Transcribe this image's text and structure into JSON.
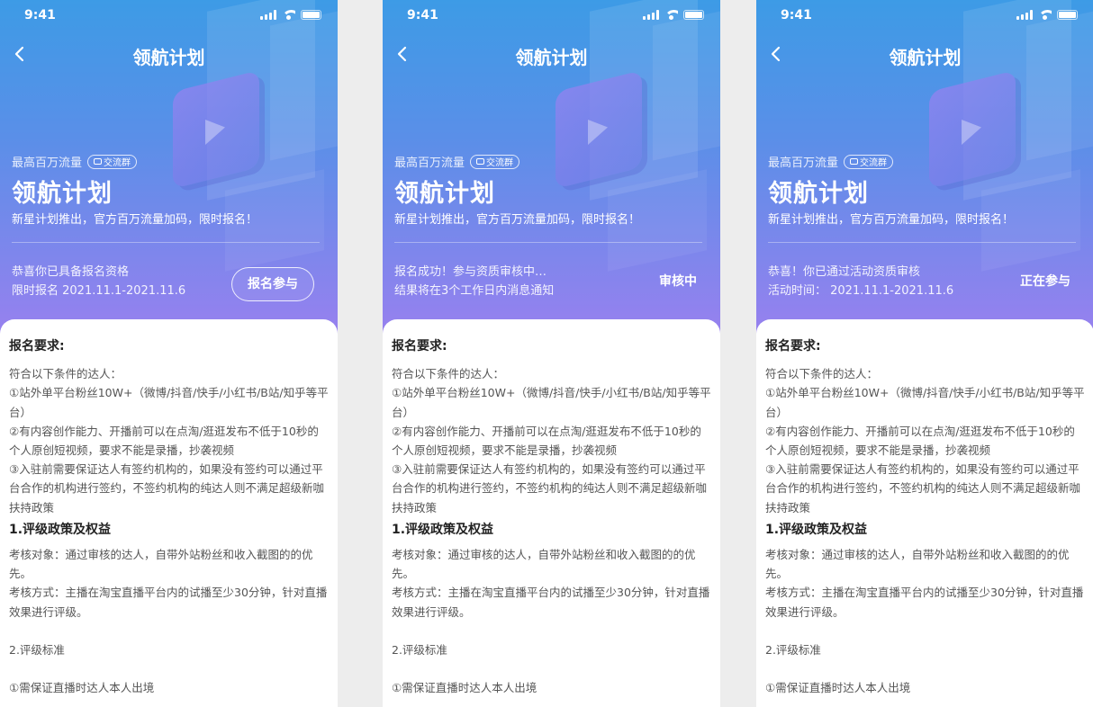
{
  "screens": [
    {
      "status_bar": {
        "time": "9:41"
      },
      "nav_title": "领航计划",
      "hero": {
        "tagline": "最高百万流量",
        "chip_label": "交流群",
        "title": "领航计划",
        "subtitle": "新星计划推出，官方百万流量加码，限时报名！",
        "status_line1": "恭喜你已具备报名资格",
        "status_line2": "限时报名 2021.11.1-2021.11.6",
        "action_label": "报名参与"
      }
    },
    {
      "status_bar": {
        "time": "9:41"
      },
      "nav_title": "领航计划",
      "hero": {
        "tagline": "最高百万流量",
        "chip_label": "交流群",
        "title": "领航计划",
        "subtitle": "新星计划推出，官方百万流量加码，限时报名！",
        "status_line1": "报名成功！参与资质审核中…",
        "status_line2": "结果将在3个工作日内消息通知",
        "state_label": "审核中"
      }
    },
    {
      "status_bar": {
        "time": "9:41"
      },
      "nav_title": "领航计划",
      "hero": {
        "tagline": "最高百万流量",
        "chip_label": "交流群",
        "title": "领航计划",
        "subtitle": "新星计划推出，官方百万流量加码，限时报名！",
        "status_line1": "恭喜！你已通过活动资质审核",
        "status_line2": "活动时间：  2021.11.1-2021.11.6",
        "state_label": "正在参与"
      }
    }
  ],
  "content": {
    "requirements_heading": "报名要求:",
    "intro": "符合以下条件的达人：",
    "items": [
      "①站外单平台粉丝10W+（微博/抖音/快手/小红书/B站/知乎等平台）",
      "②有内容创作能力、开播前可以在点淘/逛逛发布不低于10秒的个人原创短视频，要求不能是录播，抄袭视频",
      "③入驻前需要保证达人有签约机构的，如果没有签约可以通过平台合作的机构进行签约，不签约机构的纯达人则不满足超级新咖扶持政策"
    ],
    "section1_heading": "1.评级政策及权益",
    "assess_target": "考核对象：通过审核的达人，自带外站粉丝和收入截图的的优先。",
    "assess_method": "考核方式：主播在淘宝直播平台内的试播至少30分钟，针对直播效果进行评级。",
    "section2_heading": "2.评级标准",
    "standard1": "①需保证直播时达人本人出境"
  },
  "colors": {
    "gradient_top": "#3d9be6",
    "gradient_bottom": "#9a80ef",
    "text_dark": "#222222",
    "text_body": "#555555"
  }
}
